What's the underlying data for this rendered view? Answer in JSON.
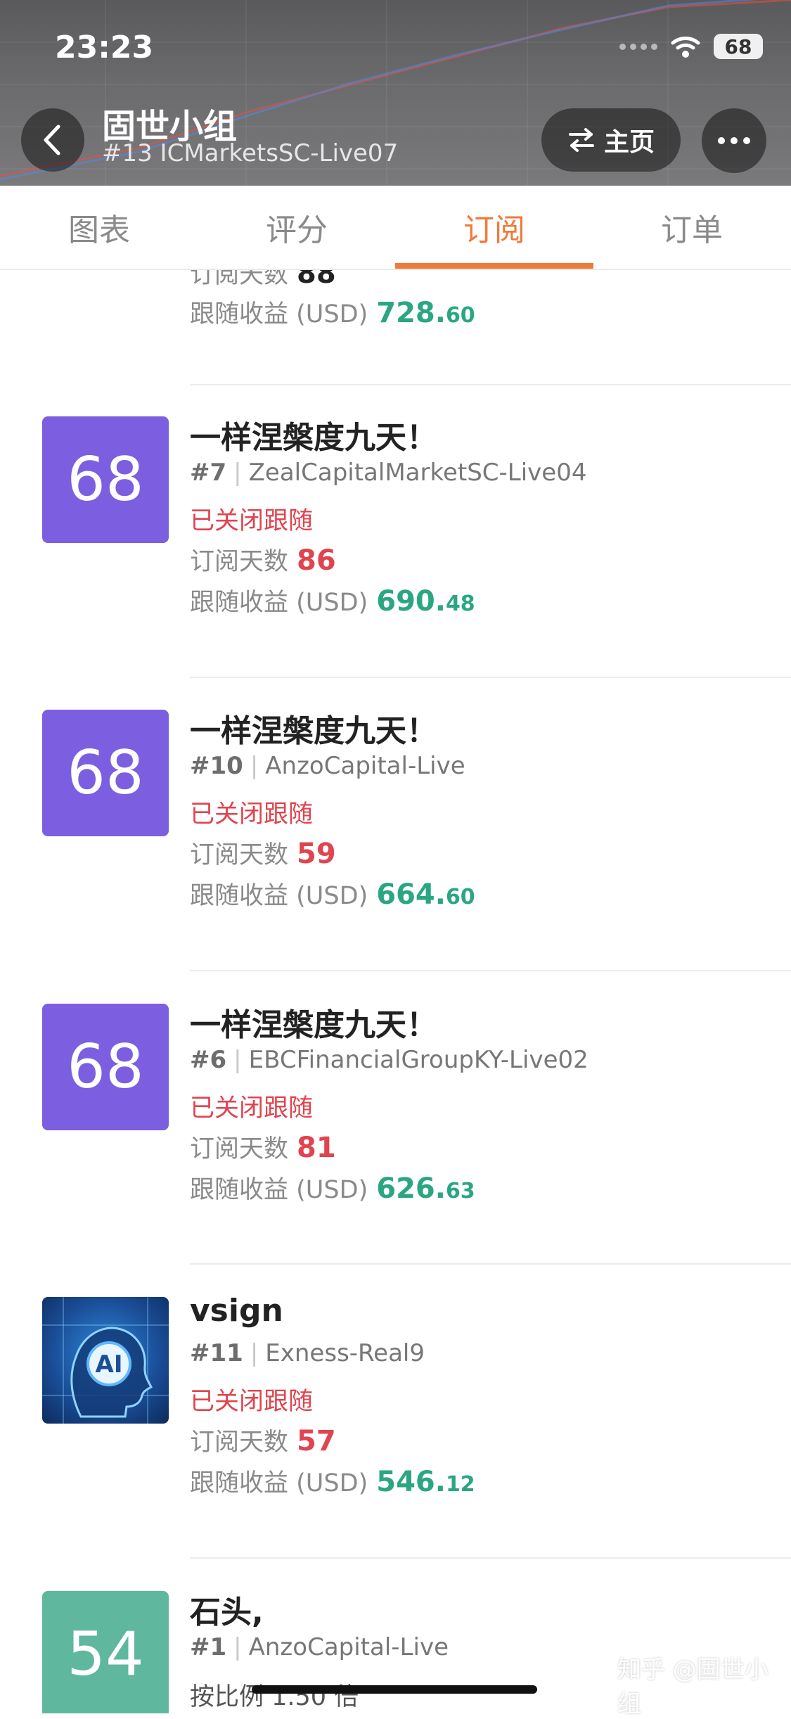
{
  "status_bar": {
    "time": "23:23",
    "battery": "68"
  },
  "header": {
    "title": "固世小组",
    "subtitle": "#13 ICMarketsSC-Live07",
    "home_label": "主页"
  },
  "tabs": [
    {
      "label": "图表",
      "active": false
    },
    {
      "label": "评分",
      "active": false
    },
    {
      "label": "订阅",
      "active": true
    },
    {
      "label": "订单",
      "active": false
    }
  ],
  "partial_row": {
    "days_label": "订阅天数",
    "days": "88",
    "profit_label": "跟随收益 (USD)",
    "profit_int": "728.",
    "profit_dec": "60"
  },
  "rows": [
    {
      "avatar": "68",
      "name": "一样涅槃度九天！",
      "rank": "#7",
      "account": "ZealCapitalMarketSC-Live04",
      "status": "已关闭跟随",
      "days_label": "订阅天数",
      "days": "86",
      "profit_label": "跟随收益 (USD)",
      "profit_int": "690.",
      "profit_dec": "48"
    },
    {
      "avatar": "68",
      "name": "一样涅槃度九天！",
      "rank": "#10",
      "account": "AnzoCapital-Live",
      "status": "已关闭跟随",
      "days_label": "订阅天数",
      "days": "59",
      "profit_label": "跟随收益 (USD)",
      "profit_int": "664.",
      "profit_dec": "60"
    },
    {
      "avatar": "68",
      "name": "一样涅槃度九天！",
      "rank": "#6",
      "account": "EBCFinancialGroupKY-Live02",
      "status": "已关闭跟随",
      "days_label": "订阅天数",
      "days": "81",
      "profit_label": "跟随收益 (USD)",
      "profit_int": "626.",
      "profit_dec": "63"
    },
    {
      "avatar": "AI",
      "name": "vsign",
      "rank": "#11",
      "account": "Exness-Real9",
      "status": "已关闭跟随",
      "days_label": "订阅天数",
      "days": "57",
      "profit_label": "跟随收益 (USD)",
      "profit_int": "546.",
      "profit_dec": "12"
    },
    {
      "avatar": "54",
      "name": "石头,",
      "rank": "#1",
      "account": "AnzoCapital-Live",
      "ratio": "按比例 1.50 倍"
    }
  ],
  "watermark": "知乎 @固世小组",
  "colors": {
    "accent": "#f07a3a",
    "closed": "#e0444f",
    "profit": "#2aa683",
    "avatar_purple": "#7b5fe0",
    "avatar_teal": "#5fb89d"
  }
}
